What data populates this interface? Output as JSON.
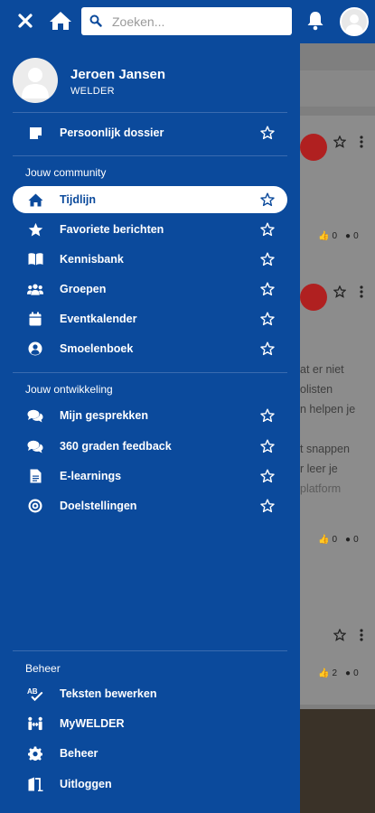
{
  "topbar": {
    "search_placeholder": "Zoeken..."
  },
  "profile": {
    "name": "Jeroen Jansen",
    "organization": "WELDER"
  },
  "menu": {
    "dossier": {
      "label": "Persoonlijk dossier",
      "icon": "note-icon"
    },
    "community_title": "Jouw community",
    "community": [
      {
        "label": "Tijdlijn",
        "icon": "home-icon",
        "active": true
      },
      {
        "label": "Favoriete berichten",
        "icon": "star-icon"
      },
      {
        "label": "Kennisbank",
        "icon": "book-icon"
      },
      {
        "label": "Groepen",
        "icon": "users-icon"
      },
      {
        "label": "Eventkalender",
        "icon": "calendar-icon"
      },
      {
        "label": "Smoelenboek",
        "icon": "user-circle-icon"
      }
    ],
    "development_title": "Jouw ontwikkeling",
    "development": [
      {
        "label": "Mijn gesprekken",
        "icon": "chat-icon"
      },
      {
        "label": "360 graden feedback",
        "icon": "chat-icon"
      },
      {
        "label": "E-learnings",
        "icon": "document-icon"
      },
      {
        "label": "Doelstellingen",
        "icon": "target-icon"
      }
    ],
    "admin_title": "Beheer",
    "admin": [
      {
        "label": "Teksten bewerken",
        "icon": "spellcheck-icon"
      },
      {
        "label": "MyWELDER",
        "icon": "people-arrows-icon"
      },
      {
        "label": "Beheer",
        "icon": "gear-icon"
      },
      {
        "label": "Uitloggen",
        "icon": "logout-door-icon"
      }
    ]
  },
  "background_feed": {
    "post1": {
      "likes": "0",
      "comments": "0"
    },
    "post2": {
      "text_lines": [
        "at er niet",
        "olisten",
        "n helpen je",
        "",
        "t snappen",
        "r leer je",
        "platform"
      ],
      "likes": "0",
      "comments": "0"
    },
    "post3": {
      "likes": "2",
      "comments": "0"
    }
  },
  "colors": {
    "brand": "#0b4a9c",
    "overlay": "#7f7f7f",
    "accent": "#b02020"
  }
}
